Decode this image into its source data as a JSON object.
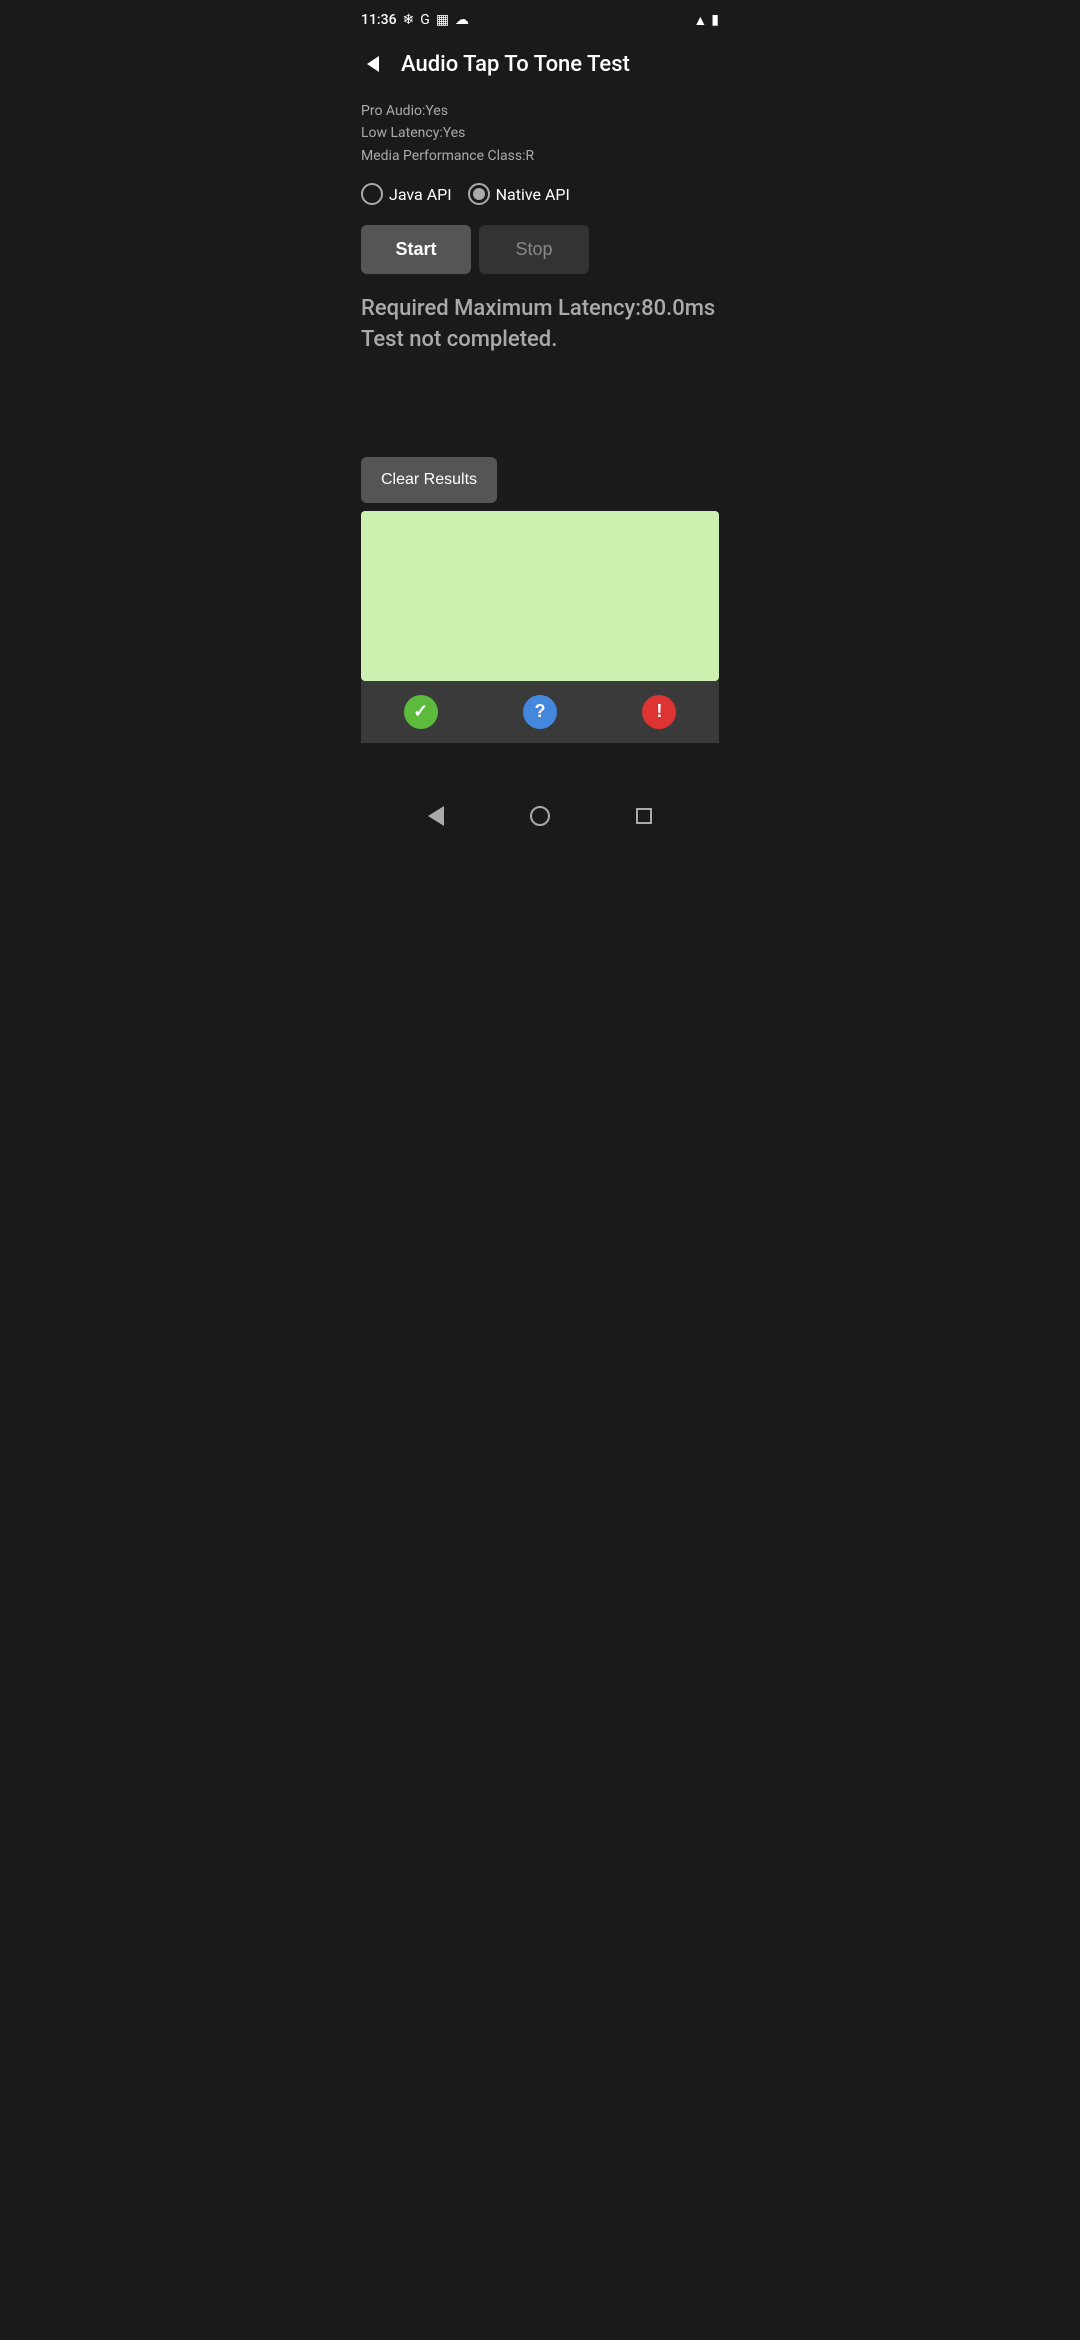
{
  "statusBar": {
    "time": "11:36",
    "icons": [
      "fan-icon",
      "google-icon",
      "calendar-icon",
      "cloud-icon"
    ],
    "wifi": "▲",
    "battery": "🔋"
  },
  "appBar": {
    "title": "Audio Tap To Tone Test",
    "backLabel": "←"
  },
  "infoLabels": {
    "proAudio": "Pro Audio:Yes",
    "lowLatency": "Low Latency:Yes",
    "mediaPerf": "Media Performance Class:R"
  },
  "radioGroup": {
    "javaApi": {
      "label": "Java API",
      "selected": false
    },
    "nativeApi": {
      "label": "Native API",
      "selected": true
    }
  },
  "buttons": {
    "start": "Start",
    "stop": "Stop"
  },
  "resultText": {
    "line1": "Required Maximum Latency:80.0ms",
    "line2": "Test not completed."
  },
  "clearResults": "Clear Results",
  "bottomActions": {
    "check": "✓",
    "question": "?",
    "warning": "!"
  },
  "navBar": {
    "back": "back",
    "home": "home",
    "recents": "recents"
  }
}
